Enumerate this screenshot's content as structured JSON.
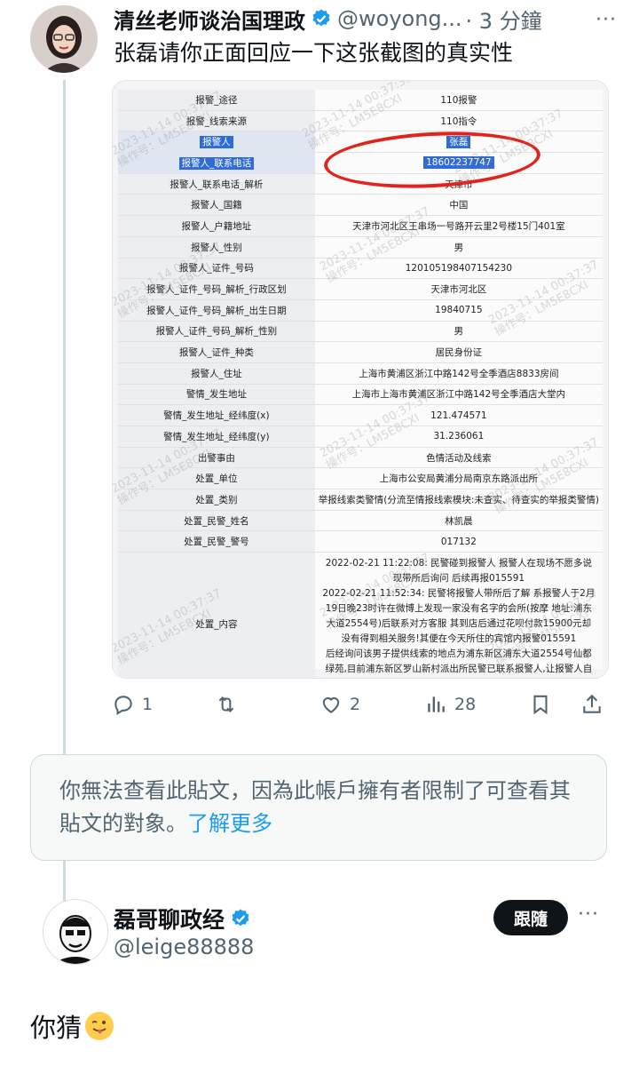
{
  "tweet1": {
    "author_name": "清丝老师谈治国理政",
    "handle": "@woyong...",
    "time": "· 3 分鐘",
    "text": "张磊请你正面回应一下这张截图的真实性",
    "more": "···"
  },
  "screenshot": {
    "rows": [
      {
        "k": "报警_途径",
        "v": "110报警"
      },
      {
        "k": "报警_线索来源",
        "v": "110指令"
      },
      {
        "k": "报警人",
        "v": "张磊",
        "hl": true
      },
      {
        "k": "报警人_联系电话",
        "v": "18602237747",
        "hl": true
      },
      {
        "k": "报警人_联系电话_解析",
        "v": "天津市"
      },
      {
        "k": "报警人_国籍",
        "v": "中国"
      },
      {
        "k": "报警人_户籍地址",
        "v": "天津市河北区王串场一号路开云里2号楼15门401室"
      },
      {
        "k": "报警人_性别",
        "v": "男"
      },
      {
        "k": "报警人_证件_号码",
        "v": "120105198407154230"
      },
      {
        "k": "报警人_证件_号码_解析_行政区划",
        "v": "天津市河北区"
      },
      {
        "k": "报警人_证件_号码_解析_出生日期",
        "v": "19840715"
      },
      {
        "k": "报警人_证件_号码_解析_性别",
        "v": "男"
      },
      {
        "k": "报警人_证件_种类",
        "v": "居民身份证"
      },
      {
        "k": "报警人_住址",
        "v": "上海市黄浦区浙江中路142号全季酒店8833房间"
      },
      {
        "k": "警情_发生地址",
        "v": "上海市上海市黄浦区浙江中路142号全季酒店大堂内"
      },
      {
        "k": "警情_发生地址_经纬度(x)",
        "v": "121.474571"
      },
      {
        "k": "警情_发生地址_经纬度(y)",
        "v": "31.236061"
      },
      {
        "k": "出警事由",
        "v": "色情活动及线索"
      },
      {
        "k": "处置_单位",
        "v": "上海市公安局黄浦分局南京东路派出所"
      },
      {
        "k": "处置_类别",
        "v": "举报线索类警情(分流至情报线索模块:未查实、待查实的举报类警情)"
      },
      {
        "k": "处置_民警_姓名",
        "v": "林凯晨"
      },
      {
        "k": "处置_民警_警号",
        "v": "017132"
      }
    ],
    "content_key": "处置_内容",
    "content_lines": [
      "2022-02-21 11:22:08: 民警碰到报警人 报警人在现场不愿多说 现带所后询问 后续再报015591",
      "2022-02-21 11:52:34: 民警将报警人带所后了解 系报警人于2月19日晚23时许在微博上发现一家没有名字的会所(按摩 地址:浦东大道2554号)后联系对方客服 其到店后通过花呗付款15900元却没有得到相关服务!其便在今天所住的宾馆内报警015591",
      "后经询问该男子提供线索的地点为浦东新区浦东大道2554号仙都绿苑,目前浦东新区罗山新村派出所民警已联系报警人,让报警人自行赶往罗山新村派出所进一步反映该情况。"
    ],
    "watermark_date": "2023-11-14 00:37:37",
    "watermark_op": "操作号：LM5E8CXI"
  },
  "actions": {
    "reply_count": "1",
    "retweet_count": "",
    "like_count": "2",
    "views_count": "28"
  },
  "notice": {
    "text": "你無法查看此貼文，因為此帳戶擁有者限制了可查看其貼文的對象。",
    "link": "了解更多"
  },
  "tweet2": {
    "author_name": "磊哥聊政经",
    "handle": "@leige88888",
    "follow_label": "跟隨",
    "more": "···",
    "text": "你猜"
  },
  "colors": {
    "verified": "#1d9bf0",
    "circle": "#e2231a",
    "highlight": "#2f6bd6"
  }
}
